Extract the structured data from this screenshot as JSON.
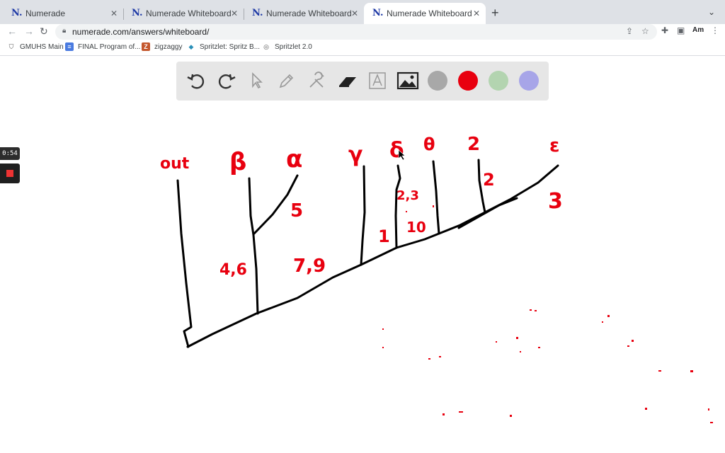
{
  "browser": {
    "tabs": [
      {
        "label": "Numerade",
        "favicon": "N."
      },
      {
        "label": "Numerade Whiteboard",
        "favicon": "N."
      },
      {
        "label": "Numerade Whiteboard",
        "favicon": "N."
      },
      {
        "label": "Numerade Whiteboard",
        "favicon": "N."
      }
    ],
    "url": "numerade.com/answers/whiteboard/",
    "profile": "Am",
    "bookmarks": [
      {
        "label": "GMUHS Main"
      },
      {
        "label": "FINAL Program of..."
      },
      {
        "label": "zigzaggy",
        "icon": "Z"
      },
      {
        "label": "Spritzlet: Spritz B..."
      },
      {
        "label": "Spritzlet 2.0"
      }
    ]
  },
  "whiteboard": {
    "tools": [
      "undo-icon",
      "redo-icon",
      "pointer-icon",
      "pen-icon",
      "tools-icon",
      "eraser-icon",
      "text-icon",
      "image-icon"
    ],
    "colors": [
      "#a8a8a8",
      "#e8000f",
      "#b3d4b0",
      "#a7a5e8"
    ],
    "timer": "0:54"
  },
  "drawing": {
    "labels": [
      "out",
      "β",
      "α",
      "γ",
      "δ",
      "θ",
      "2",
      "ε",
      "5",
      "2,3",
      "10",
      "1",
      "4,6",
      "7,9",
      "2",
      "3"
    ]
  }
}
